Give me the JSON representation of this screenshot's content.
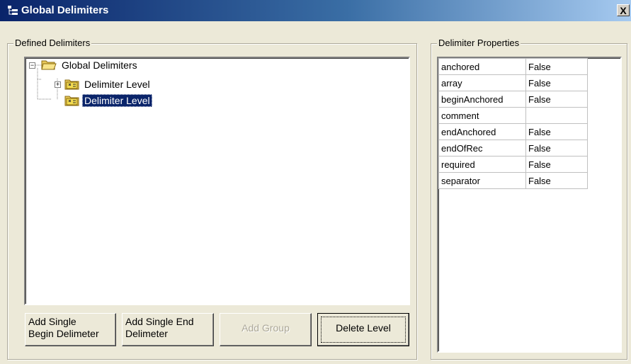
{
  "window": {
    "title": "Global Delimiters",
    "close_label": "X"
  },
  "defined": {
    "label": "Defined Delimiters",
    "tree": {
      "root": {
        "label": "Global Delimiters",
        "expanded": true
      },
      "children": [
        {
          "label": "Delimiter Level",
          "expander": "+",
          "selected": false
        },
        {
          "label": "Delimiter Level",
          "expander": "",
          "selected": true
        }
      ]
    },
    "buttons": {
      "add_begin": [
        "Add Single",
        "Begin Delimeter"
      ],
      "add_end": [
        "Add Single End",
        "Delimeter"
      ],
      "add_group": "Add Group",
      "delete_level": "Delete Level"
    }
  },
  "properties": {
    "label": "Delimiter Properties",
    "rows": [
      {
        "key": "anchored",
        "value": "False"
      },
      {
        "key": "array",
        "value": "False"
      },
      {
        "key": "beginAnchored",
        "value": "False"
      },
      {
        "key": "comment",
        "value": ""
      },
      {
        "key": "endAnchored",
        "value": "False"
      },
      {
        "key": "endOfRec",
        "value": "False"
      },
      {
        "key": "required",
        "value": "False"
      },
      {
        "key": "separator",
        "value": "False"
      }
    ]
  },
  "colors": {
    "titlebar_start": "#0a246a",
    "titlebar_end": "#a6caf0",
    "selection": "#0a246a",
    "dialog_bg": "#ece9d8"
  },
  "icons": {
    "title": "tree-view-icon",
    "root": "open-folder-icon",
    "child": "delimiter-folder-icon",
    "close": "close-icon"
  }
}
